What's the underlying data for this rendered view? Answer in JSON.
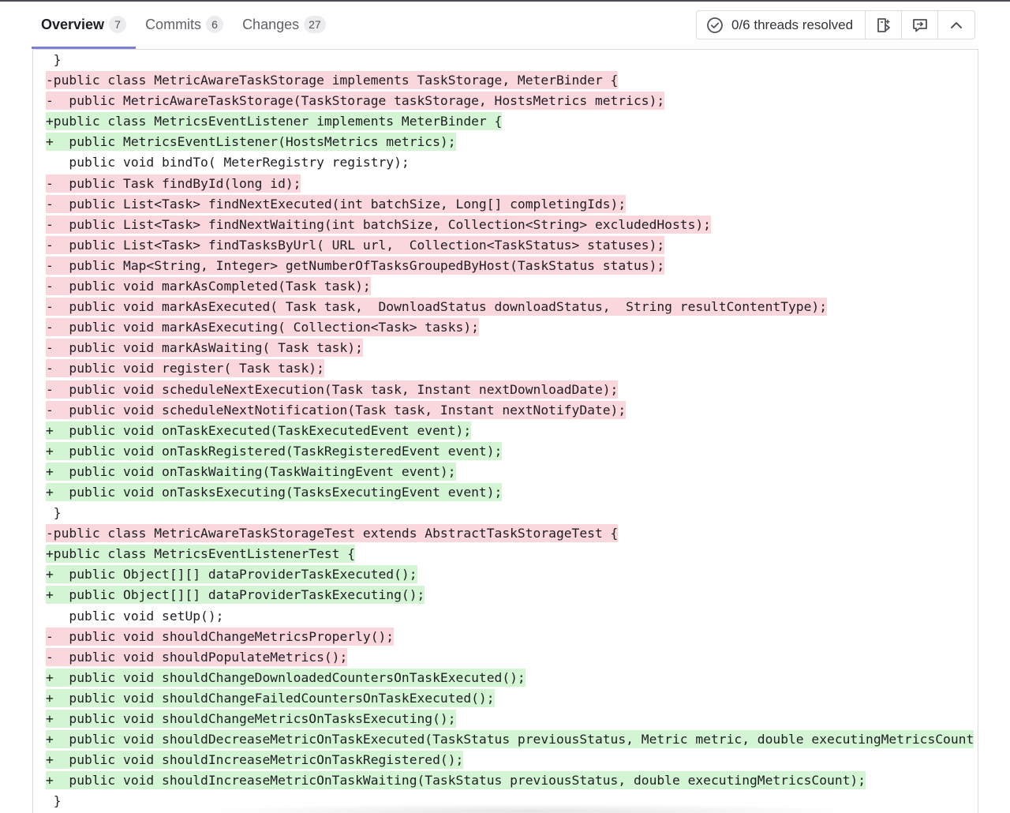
{
  "tabs": [
    {
      "label": "Overview",
      "count": "7"
    },
    {
      "label": "Commits",
      "count": "6"
    },
    {
      "label": "Changes",
      "count": "27"
    }
  ],
  "toolbar": {
    "threads_label": "0/6 threads resolved"
  },
  "diff_lines": [
    {
      "type": "ctx",
      "text": " }"
    },
    {
      "type": "del",
      "text": "-public class MetricAwareTaskStorage implements TaskStorage, MeterBinder {"
    },
    {
      "type": "del",
      "text": "-  public MetricAwareTaskStorage(TaskStorage taskStorage, HostsMetrics metrics);"
    },
    {
      "type": "add",
      "text": "+public class MetricsEventListener implements MeterBinder {"
    },
    {
      "type": "add",
      "text": "+  public MetricsEventListener(HostsMetrics metrics);"
    },
    {
      "type": "ctx",
      "text": "   public void bindTo( MeterRegistry registry);"
    },
    {
      "type": "del",
      "text": "-  public Task findById(long id);"
    },
    {
      "type": "del",
      "text": "-  public List<Task> findNextExecuted(int batchSize, Long[] completingIds);"
    },
    {
      "type": "del",
      "text": "-  public List<Task> findNextWaiting(int batchSize, Collection<String> excludedHosts);"
    },
    {
      "type": "del",
      "text": "-  public List<Task> findTasksByUrl( URL url,  Collection<TaskStatus> statuses);"
    },
    {
      "type": "del",
      "text": "-  public Map<String, Integer> getNumberOfTasksGroupedByHost(TaskStatus status);"
    },
    {
      "type": "del",
      "text": "-  public void markAsCompleted(Task task);"
    },
    {
      "type": "del",
      "text": "-  public void markAsExecuted( Task task,  DownloadStatus downloadStatus,  String resultContentType);"
    },
    {
      "type": "del",
      "text": "-  public void markAsExecuting( Collection<Task> tasks);"
    },
    {
      "type": "del",
      "text": "-  public void markAsWaiting( Task task);"
    },
    {
      "type": "del",
      "text": "-  public void register( Task task);"
    },
    {
      "type": "del",
      "text": "-  public void scheduleNextExecution(Task task, Instant nextDownloadDate);"
    },
    {
      "type": "del",
      "text": "-  public void scheduleNextNotification(Task task, Instant nextNotifyDate);"
    },
    {
      "type": "add",
      "text": "+  public void onTaskExecuted(TaskExecutedEvent event);"
    },
    {
      "type": "add",
      "text": "+  public void onTaskRegistered(TaskRegisteredEvent event);"
    },
    {
      "type": "add",
      "text": "+  public void onTaskWaiting(TaskWaitingEvent event);"
    },
    {
      "type": "add",
      "text": "+  public void onTasksExecuting(TasksExecutingEvent event);"
    },
    {
      "type": "ctx",
      "text": " }"
    },
    {
      "type": "del",
      "text": "-public class MetricAwareTaskStorageTest extends AbstractTaskStorageTest {"
    },
    {
      "type": "add",
      "text": "+public class MetricsEventListenerTest {"
    },
    {
      "type": "add",
      "text": "+  public Object[][] dataProviderTaskExecuted();"
    },
    {
      "type": "add",
      "text": "+  public Object[][] dataProviderTaskExecuting();"
    },
    {
      "type": "ctx",
      "text": "   public void setUp();"
    },
    {
      "type": "del",
      "text": "-  public void shouldChangeMetricsProperly();"
    },
    {
      "type": "del",
      "text": "-  public void shouldPopulateMetrics();"
    },
    {
      "type": "add",
      "text": "+  public void shouldChangeDownloadedCountersOnTaskExecuted();"
    },
    {
      "type": "add",
      "text": "+  public void shouldChangeFailedCountersOnTaskExecuted();"
    },
    {
      "type": "add",
      "text": "+  public void shouldChangeMetricsOnTasksExecuting();"
    },
    {
      "type": "add",
      "text": "+  public void shouldDecreaseMetricOnTaskExecuted(TaskStatus previousStatus, Metric metric, double executingMetricsCount"
    },
    {
      "type": "add",
      "text": "+  public void shouldIncreaseMetricOnTaskRegistered();"
    },
    {
      "type": "add",
      "text": "+  public void shouldIncreaseMetricOnTaskWaiting(TaskStatus previousStatus, double executingMetricsCount);"
    },
    {
      "type": "ctx",
      "text": " }"
    }
  ]
}
